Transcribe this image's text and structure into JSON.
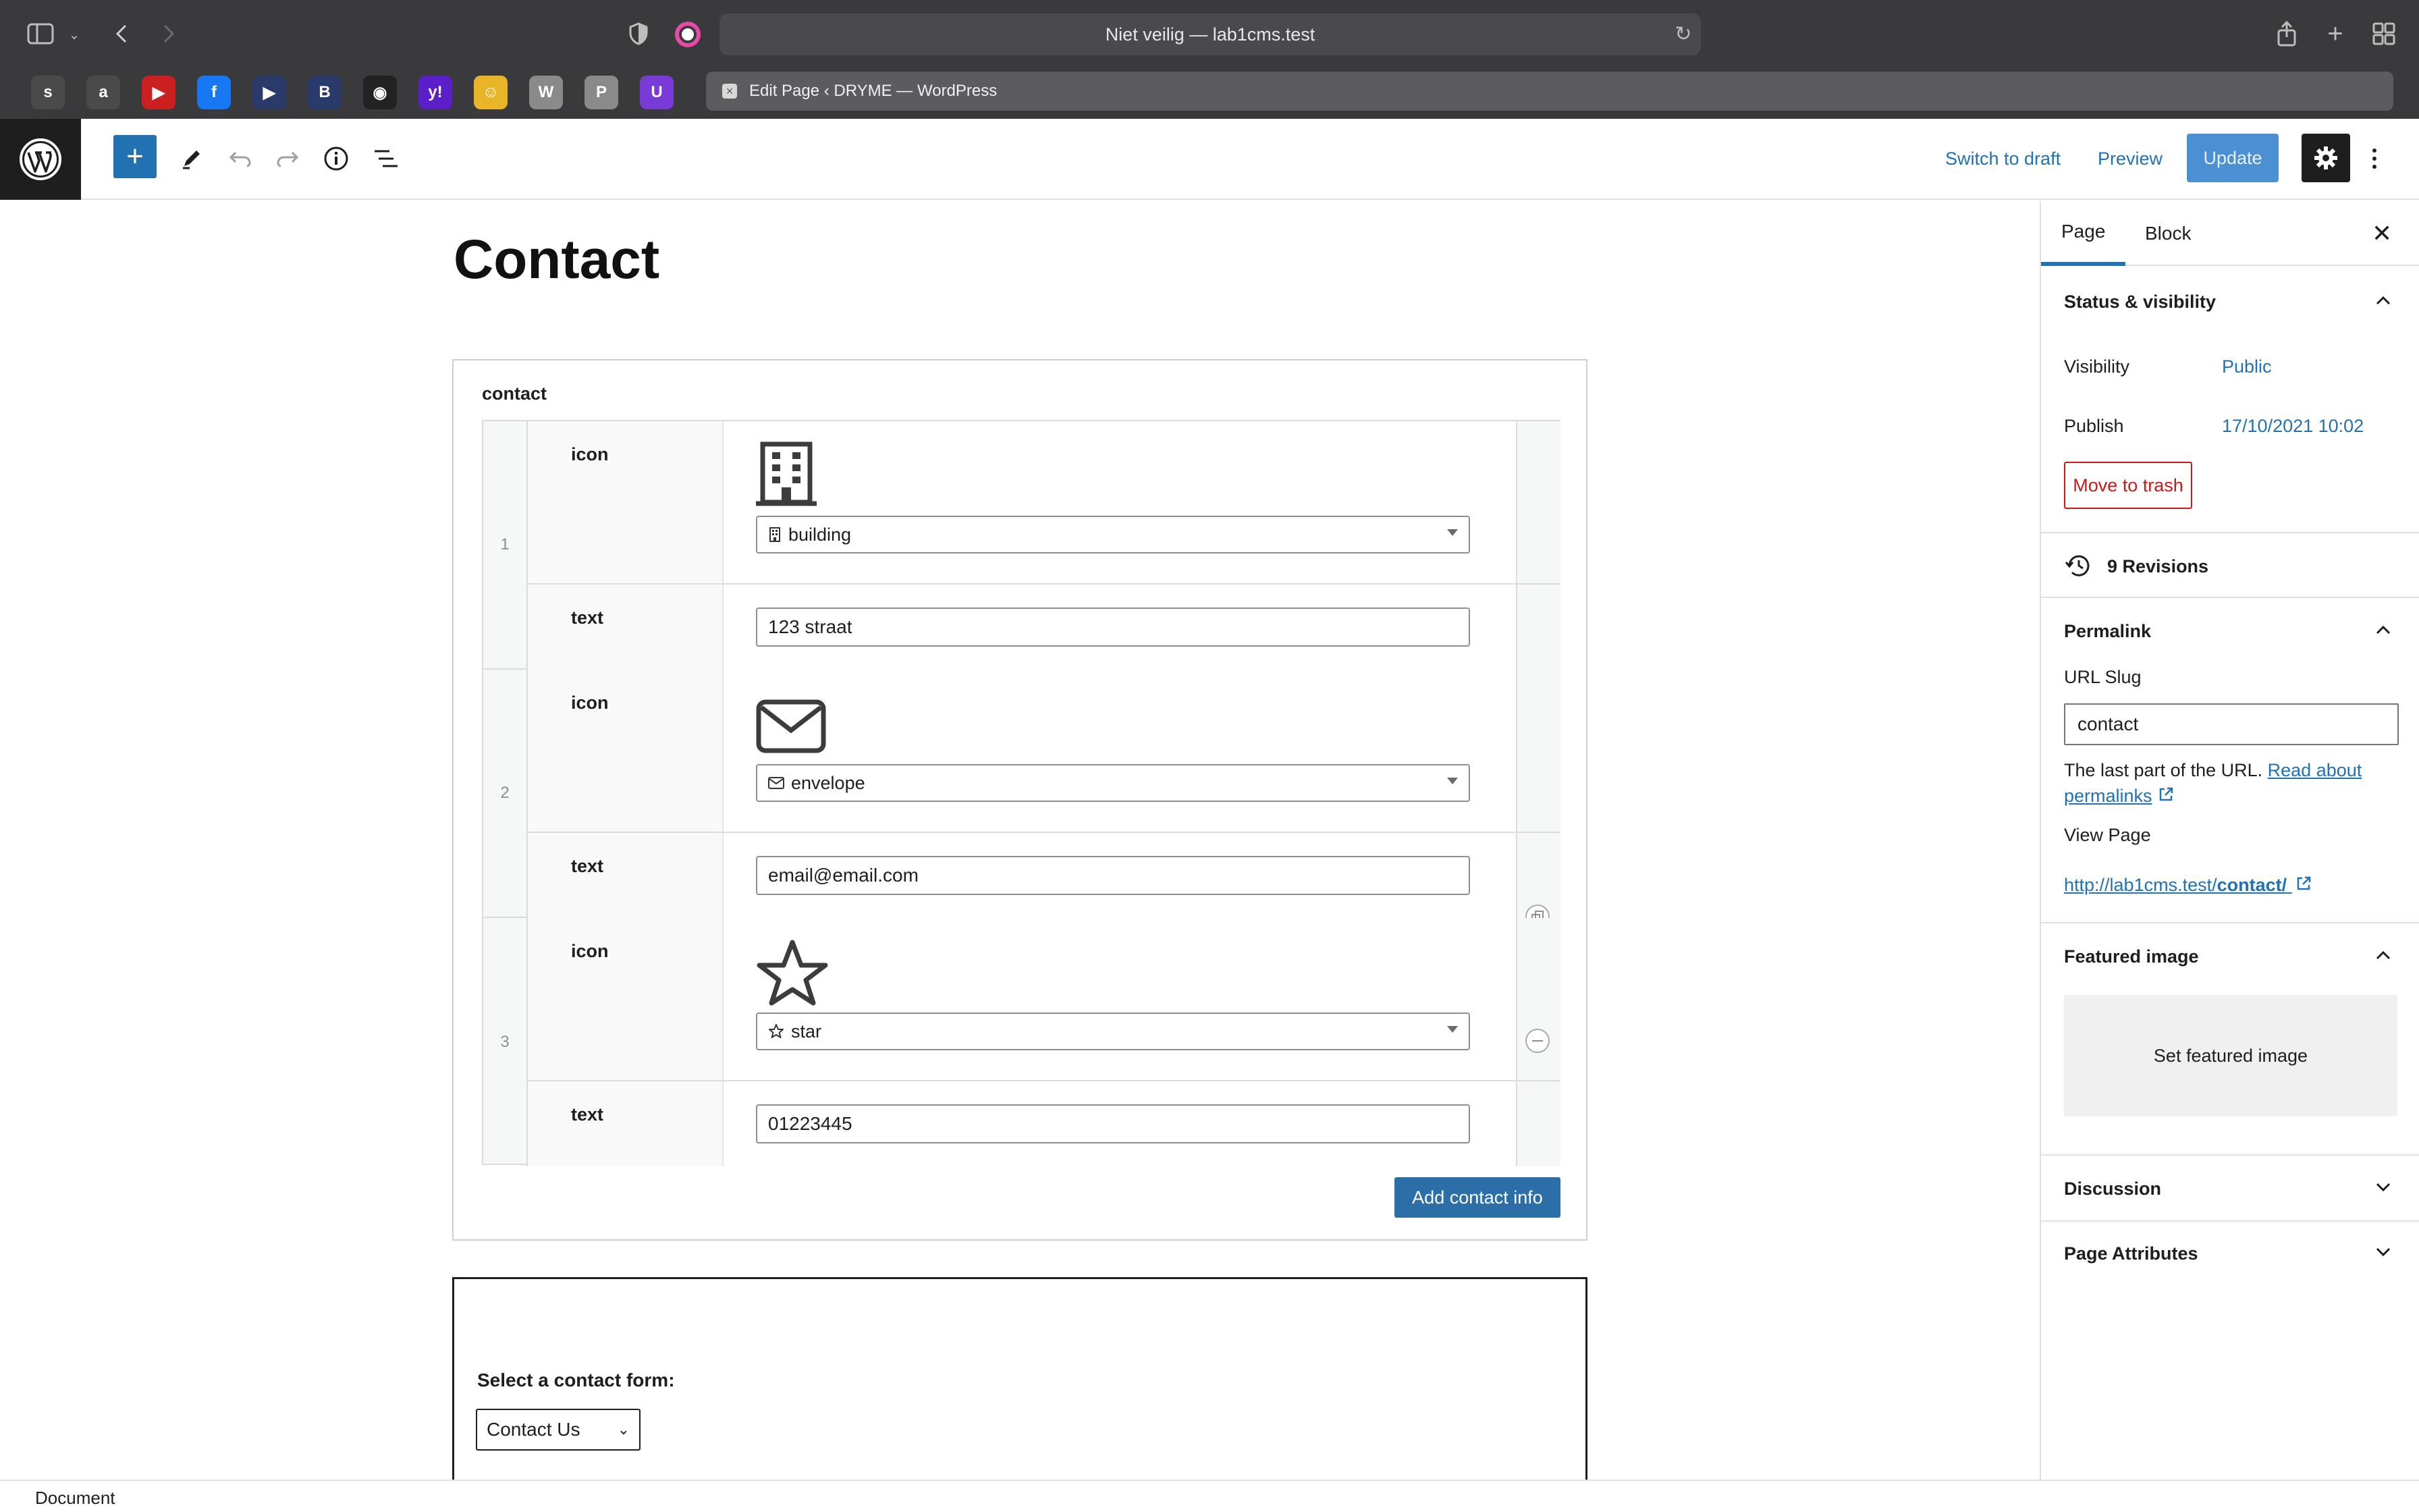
{
  "browser": {
    "address": "Niet veilig — lab1cms.test",
    "active_tab": "Edit Page ‹ DRYME — WordPress",
    "favorites": [
      {
        "icon": "s",
        "color": "#4a4a4a"
      },
      {
        "icon": "a",
        "color": "#4a4a4a"
      },
      {
        "icon": "▶",
        "color": "#cc2020"
      },
      {
        "icon": "f",
        "color": "#1877f2"
      },
      {
        "icon": "▶",
        "color": "#2a3a6a"
      },
      {
        "icon": "B",
        "color": "#2a3a6a"
      },
      {
        "icon": "◉",
        "color": "#222222"
      },
      {
        "icon": "y!",
        "color": "#5a1fc8"
      },
      {
        "icon": "☺",
        "color": "#e8b428"
      },
      {
        "icon": "W",
        "color": "#8a8a8a"
      },
      {
        "icon": "P",
        "color": "#8a8a8a"
      },
      {
        "icon": "U",
        "color": "#7a3ad8"
      }
    ]
  },
  "editor_header": {
    "switch_draft": "Switch to draft",
    "preview": "Preview",
    "update": "Update"
  },
  "page": {
    "title": "Contact"
  },
  "acf_block": {
    "label": "contact",
    "rows": [
      {
        "num": "1",
        "icon_label": "icon",
        "icon_value": "building",
        "text_label": "text",
        "text_value": "123 straat"
      },
      {
        "num": "2",
        "icon_label": "icon",
        "icon_value": "envelope",
        "text_label": "text",
        "text_value": "email@email.com"
      },
      {
        "num": "3",
        "icon_label": "icon",
        "icon_value": "star",
        "text_label": "text",
        "text_value": "01223445"
      }
    ],
    "add_button": "Add contact info"
  },
  "form_block": {
    "label": "Select a contact form:",
    "selected": "Contact Us"
  },
  "sidebar": {
    "tabs": [
      "Page",
      "Block"
    ],
    "status_title": "Status & visibility",
    "visibility_label": "Visibility",
    "visibility_value": "Public",
    "publish_label": "Publish",
    "publish_value": "17/10/2021 10:02",
    "trash": "Move to trash",
    "revisions": "9 Revisions",
    "permalink_title": "Permalink",
    "url_slug_label": "URL Slug",
    "url_slug_value": "contact",
    "help_text": "The last part of the URL.",
    "help_link1": "Read about",
    "help_link2": "permalinks",
    "view_page_label": "View Page",
    "view_page_url_prefix": "http://lab1cms.test/",
    "view_page_url_slug": "contact/",
    "featured_title": "Featured image",
    "set_featured": "Set featured image",
    "discussion": "Discussion",
    "page_attributes": "Page Attributes"
  },
  "footer": {
    "crumb": "Document"
  },
  "colors": {
    "accent": "#2271b1",
    "danger": "#cc1818",
    "update_button": "#4a90d2",
    "add_button": "#2c6ea8"
  }
}
